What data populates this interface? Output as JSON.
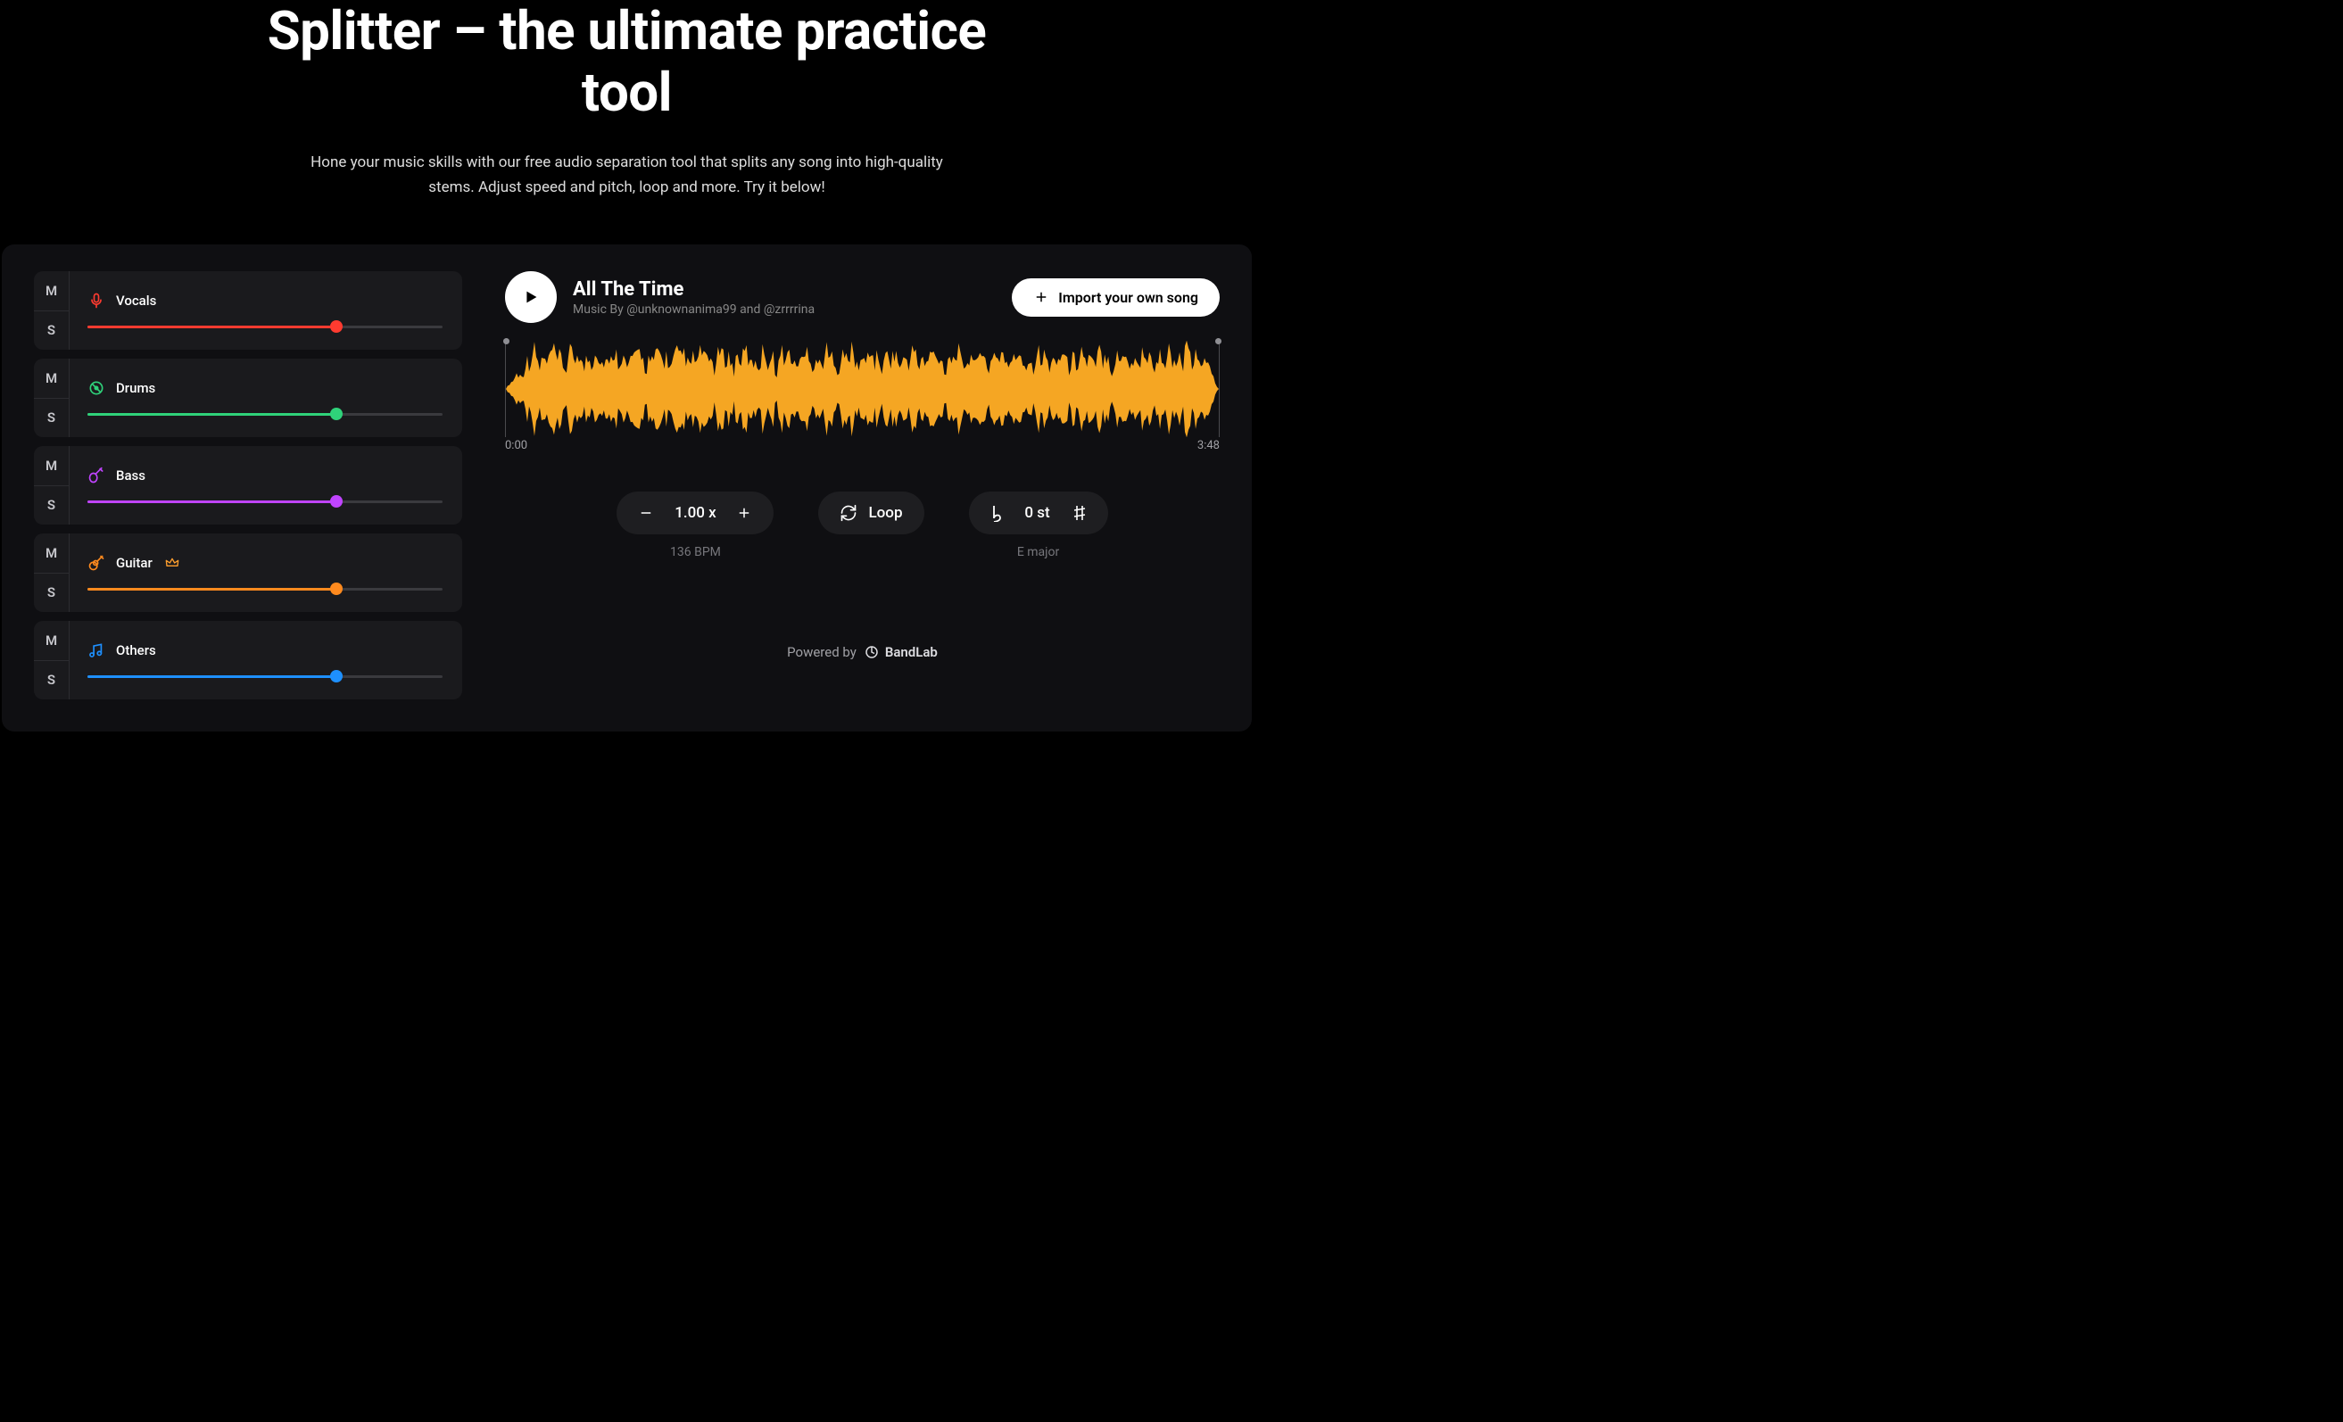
{
  "hero": {
    "title": "Splitter – the ultimate practice tool",
    "subtitle": "Hone your music skills with our free audio separation tool that splits any song into high-quality stems. Adjust speed and pitch, loop and more. Try it below!"
  },
  "stems": [
    {
      "name": "Vocals",
      "icon": "mic",
      "color": "#ff3b30",
      "pct": 70,
      "premium": false
    },
    {
      "name": "Drums",
      "icon": "target",
      "color": "#2fd27a",
      "pct": 70,
      "premium": false
    },
    {
      "name": "Bass",
      "icon": "bass",
      "color": "#c044ff",
      "pct": 70,
      "premium": false
    },
    {
      "name": "Guitar",
      "icon": "guitar",
      "color": "#ff8a1e",
      "pct": 70,
      "premium": true
    },
    {
      "name": "Others",
      "icon": "note",
      "color": "#1e90ff",
      "pct": 70,
      "premium": false
    }
  ],
  "ms": {
    "mute": "M",
    "solo": "S"
  },
  "track": {
    "title": "All The Time",
    "byline": "Music By @unknownanima99 and @zrrrrina",
    "start": "0:00",
    "end": "3:48"
  },
  "import_label": "Import your own song",
  "speed": {
    "value": "1.00 x",
    "bpm": "136 BPM"
  },
  "loop": {
    "label": "Loop"
  },
  "pitch": {
    "value": "0 st",
    "key": "E major"
  },
  "footer": {
    "prefix": "Powered by",
    "brand": "BandLab"
  },
  "colors": {
    "wave": "#f5a623"
  }
}
